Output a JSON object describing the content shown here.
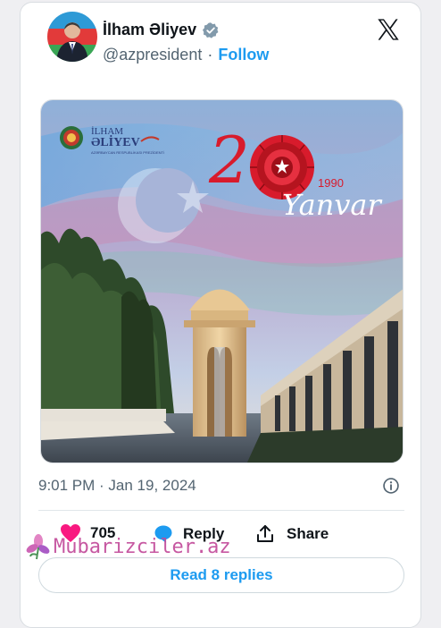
{
  "tweet": {
    "author_name": "İlham Əliyev",
    "handle": "@azpresident",
    "separator": "·",
    "follow_label": "Follow",
    "timestamp": "9:01 PM · Jan 19, 2024"
  },
  "media": {
    "logo_name": "İLHAM",
    "logo_surname": "ƏLİYEV",
    "logo_tagline": "AZƏRBAYCAN RESPUBLİKASI PREZİDENTİ",
    "big_number_digit": "2",
    "year": "1990",
    "month": "Yanvar"
  },
  "actions": {
    "likes_count": "705",
    "reply_label": "Reply",
    "share_label": "Share",
    "read_replies_label": "Read 8 replies"
  },
  "watermark": {
    "text": "Mubarizciler.az"
  },
  "colors": {
    "accent_blue": "#1d9bf0",
    "like_pink": "#f91880",
    "text_primary": "#0f1419",
    "text_secondary": "#536471",
    "carnation_red": "#d81b2c"
  }
}
